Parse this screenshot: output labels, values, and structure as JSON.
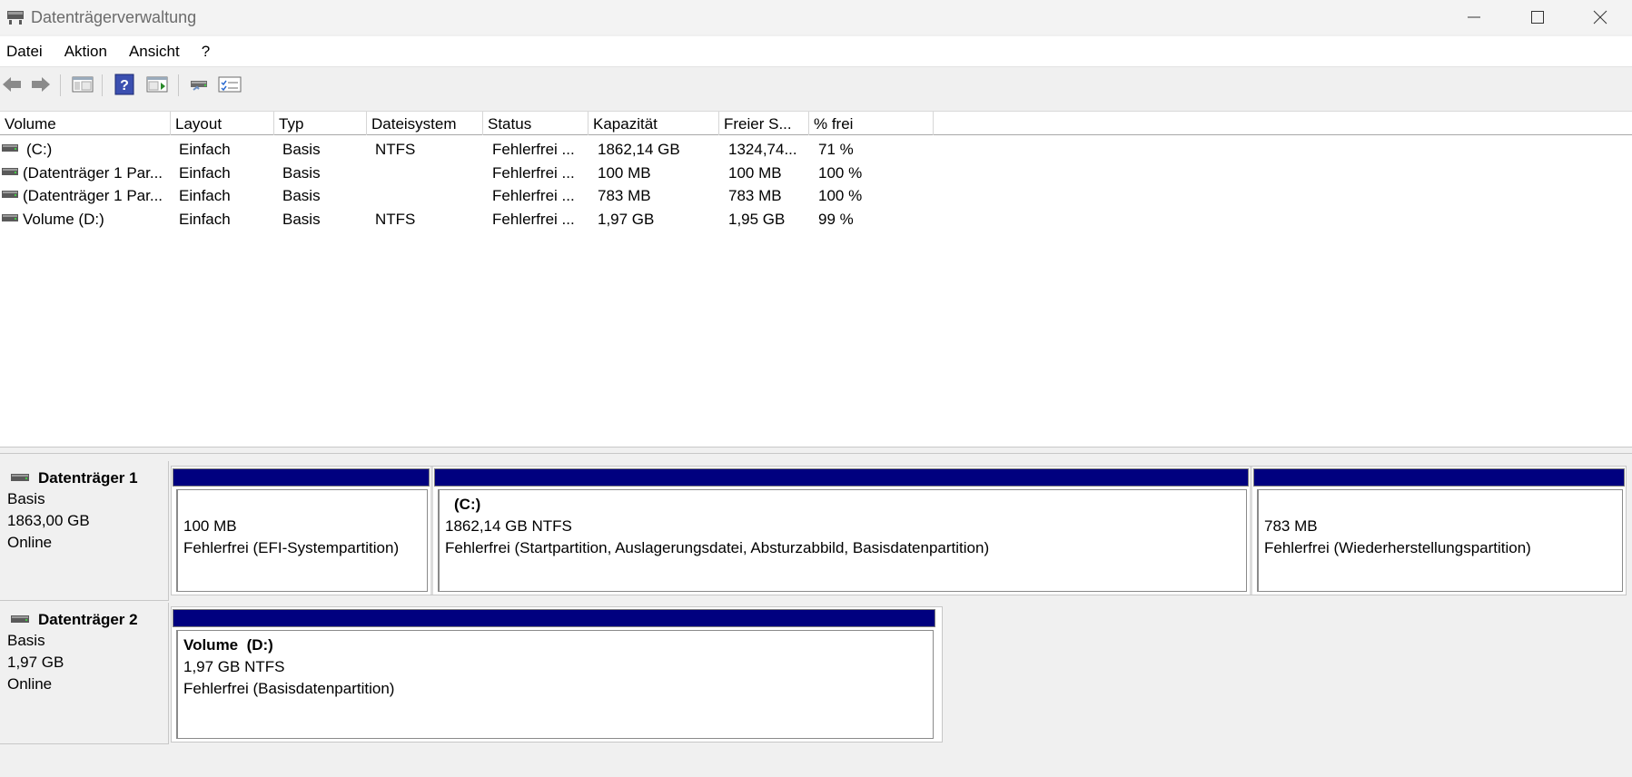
{
  "window": {
    "title": "Datenträgerverwaltung"
  },
  "menu": [
    "Datei",
    "Aktion",
    "Ansicht",
    "?"
  ],
  "toolbar": {
    "buttons": [
      "back-arrow-icon",
      "forward-arrow-icon",
      "console-tree-icon",
      "help-icon",
      "action-pane-icon",
      "disk-list-icon",
      "properties-icon"
    ]
  },
  "volume_table": {
    "columns": [
      "Volume",
      "Layout",
      "Typ",
      "Dateisystem",
      "Status",
      "Kapazität",
      "Freier S...",
      "% frei"
    ],
    "rows": [
      [
        "(C:)",
        "Einfach",
        "Basis",
        "NTFS",
        "Fehlerfrei ...",
        "1862,14 GB",
        "1324,74...",
        "71 %"
      ],
      [
        "(Datenträger 1 Par...",
        "Einfach",
        "Basis",
        "",
        "Fehlerfrei ...",
        "100 MB",
        "100 MB",
        "100 %"
      ],
      [
        "(Datenträger 1 Par...",
        "Einfach",
        "Basis",
        "",
        "Fehlerfrei ...",
        "783 MB",
        "783 MB",
        "100 %"
      ],
      [
        "Volume (D:)",
        "Einfach",
        "Basis",
        "NTFS",
        "Fehlerfrei ...",
        "1,97 GB",
        "1,95 GB",
        "99 %"
      ]
    ]
  },
  "disks": [
    {
      "name": "Datenträger 1",
      "type": "Basis",
      "size": "1863,00 GB",
      "status": "Online",
      "partitions": [
        {
          "title": "",
          "line1": "100 MB",
          "line2": "Fehlerfrei (EFI-Systempartition)"
        },
        {
          "title": "(C:)",
          "line1": "1862,14 GB NTFS",
          "line2": "Fehlerfrei (Startpartition, Auslagerungsdatei, Absturzabbild, Basisdatenpartition)"
        },
        {
          "title": "",
          "line1": "783 MB",
          "line2": "Fehlerfrei (Wiederherstellungspartition)"
        }
      ]
    },
    {
      "name": "Datenträger 2",
      "type": "Basis",
      "size": "1,97 GB",
      "status": "Online",
      "partitions": [
        {
          "title": "Volume  (D:)",
          "line1": "1,97 GB NTFS",
          "line2": "Fehlerfrei (Basisdatenpartition)"
        }
      ]
    }
  ],
  "colors": {
    "partition_bar": "#00007f",
    "title_text": "#6b6b6b"
  }
}
